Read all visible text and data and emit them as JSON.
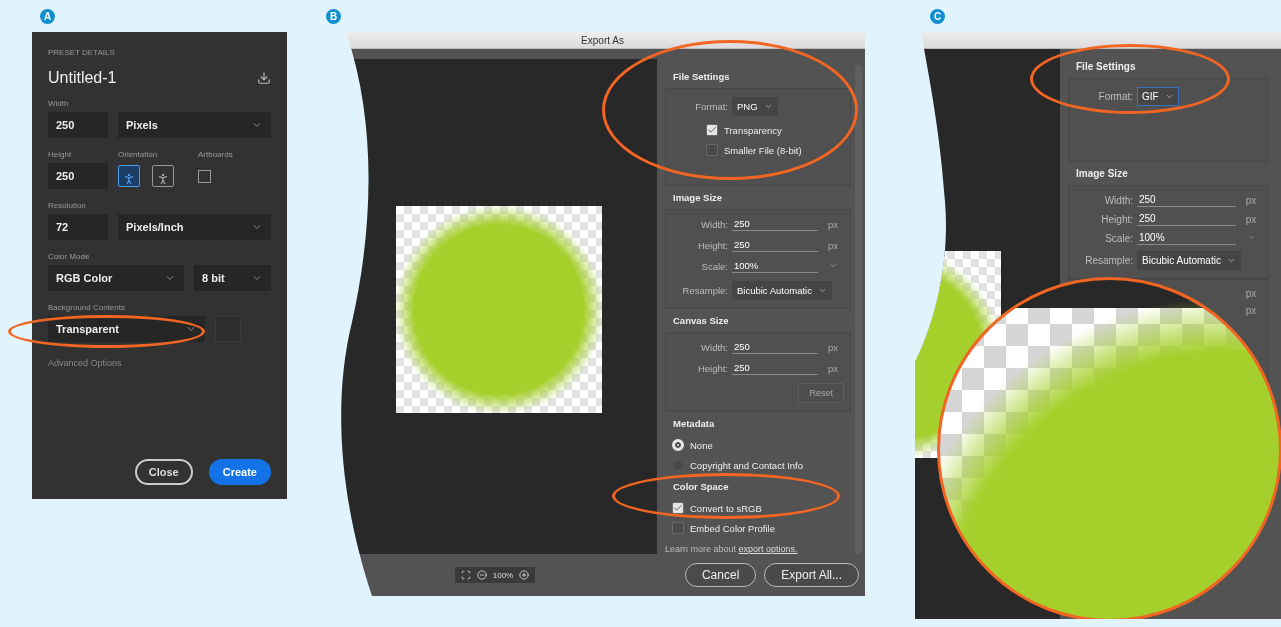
{
  "new_document": {
    "badge": "A",
    "section_title": "PRESET DETAILS",
    "name": "Untitled-1",
    "width": {
      "label": "Width",
      "value": "250",
      "unit": "Pixels"
    },
    "height": {
      "label": "Height",
      "value": "250"
    },
    "orientation": {
      "label": "Orientation",
      "options": [
        {
          "selected": true
        },
        {
          "selected": false
        }
      ]
    },
    "artboards": {
      "label": "Artboards",
      "checked": false
    },
    "resolution": {
      "label": "Resolution",
      "value": "72",
      "unit": "Pixels/Inch"
    },
    "color_mode": {
      "label": "Color Mode",
      "mode": "RGB Color",
      "depth": "8 bit"
    },
    "background_contents": {
      "label": "Background Contents",
      "value": "Transparent"
    },
    "advanced_options": "Advanced Options",
    "buttons": [
      {
        "label": "Close",
        "kind": "secondary"
      },
      {
        "label": "Create",
        "kind": "primary"
      }
    ]
  },
  "export_png": {
    "badge": "B",
    "title": "Export As",
    "zoom": "100%",
    "sections": [
      {
        "title": "File Settings",
        "rows": [
          {
            "kind": "select",
            "label": "Format:",
            "value": "PNG",
            "focused": false
          },
          {
            "kind": "checkbox",
            "label": "Transparency",
            "checked": true
          },
          {
            "kind": "checkbox",
            "label": "Smaller File (8-bit)",
            "checked": false
          }
        ]
      },
      {
        "title": "Image Size",
        "rows": [
          {
            "kind": "input",
            "label": "Width:",
            "value": "250",
            "unit": "px"
          },
          {
            "kind": "input",
            "label": "Height:",
            "value": "250",
            "unit": "px"
          },
          {
            "kind": "combo",
            "label": "Scale:",
            "value": "100%"
          },
          {
            "kind": "select",
            "label": "Resample:",
            "value": "Bicubic Automatic",
            "focused": false
          }
        ]
      },
      {
        "title": "Canvas Size",
        "rows": [
          {
            "kind": "input",
            "label": "Width:",
            "value": "250",
            "unit": "px"
          },
          {
            "kind": "input",
            "label": "Height:",
            "value": "250",
            "unit": "px"
          },
          {
            "kind": "button",
            "label": "Reset",
            "disabled": true
          }
        ]
      },
      {
        "title": "Metadata",
        "rows": [
          {
            "kind": "radio",
            "label": "None",
            "selected": true
          },
          {
            "kind": "radio",
            "label": "Copyright and Contact Info",
            "selected": false
          }
        ]
      },
      {
        "title": "Color Space",
        "rows": [
          {
            "kind": "checkbox",
            "label": "Convert to sRGB",
            "checked": true
          },
          {
            "kind": "checkbox",
            "label": "Embed Color Profile",
            "checked": false
          }
        ]
      }
    ],
    "learn_more": {
      "text": "Learn more about",
      "link": "export options."
    },
    "buttons": [
      {
        "label": "Cancel"
      },
      {
        "label": "Export All..."
      }
    ]
  },
  "export_gif": {
    "badge": "C",
    "sections": [
      {
        "title": "File Settings",
        "rows": [
          {
            "kind": "select",
            "label": "Format:",
            "value": "GIF",
            "focused": true
          }
        ]
      },
      {
        "title": "Image Size",
        "rows": [
          {
            "kind": "input",
            "label": "Width:",
            "value": "250",
            "unit": "px"
          },
          {
            "kind": "input",
            "label": "Height:",
            "value": "250",
            "unit": "px"
          },
          {
            "kind": "combo",
            "label": "Scale:",
            "value": "100%"
          },
          {
            "kind": "select",
            "label": "Resample:",
            "value": "Bicubic Automatic",
            "focused": false
          }
        ]
      },
      {
        "rows": [
          {
            "kind": "unit",
            "unit": "px"
          },
          {
            "kind": "unit",
            "unit": "px"
          }
        ]
      }
    ]
  }
}
